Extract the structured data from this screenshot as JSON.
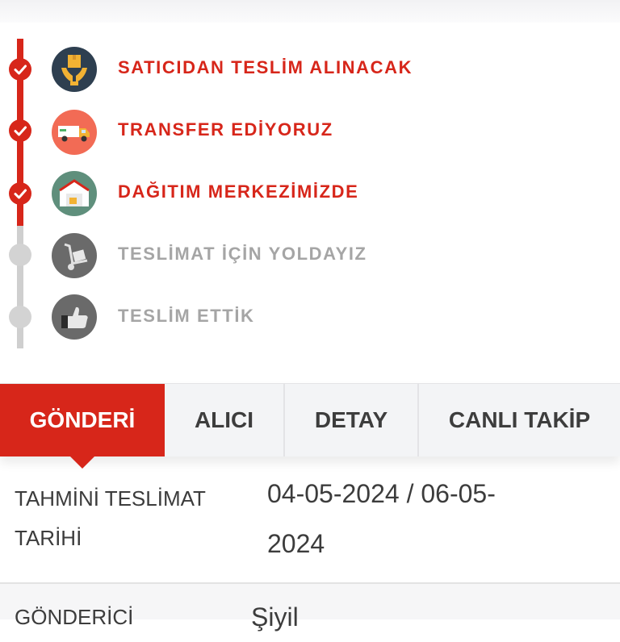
{
  "timeline": {
    "steps": [
      {
        "label": "SATICIDAN TESLİM ALINACAK",
        "status": "done",
        "icon": "hands-box-icon"
      },
      {
        "label": "TRANSFER EDİYORUZ",
        "status": "done",
        "icon": "truck-icon"
      },
      {
        "label": "DAĞITIM MERKEZİMİZDE",
        "status": "done",
        "icon": "warehouse-icon"
      },
      {
        "label": "TESLİMAT İÇİN YOLDAYIZ",
        "status": "pending",
        "icon": "hand-truck-icon"
      },
      {
        "label": "TESLİM ETTİK",
        "status": "pending",
        "icon": "thumbs-up-icon"
      }
    ]
  },
  "tabs": {
    "items": [
      "GÖNDERİ",
      "ALICI",
      "DETAY",
      "CANLI TAKİP"
    ],
    "active": "GÖNDERİ"
  },
  "shipment": {
    "estimated_label_line1": "TAHMİNİ TESLİMAT",
    "estimated_label_line2": "TARİHİ",
    "estimated_value_line1": "04-05-2024 / 06-05-",
    "estimated_value_line2": "2024",
    "sender_label": "GÖNDERİCİ",
    "sender_value": "Şiyil"
  },
  "colors": {
    "accent": "#d7261a",
    "pending": "#a5a5a5",
    "text": "#3c3c3c",
    "tab_bg": "#f3f4f6"
  }
}
